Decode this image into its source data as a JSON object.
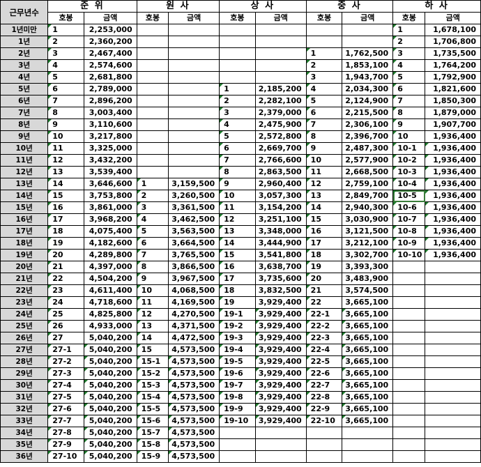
{
  "header": {
    "years_label": "근무년수",
    "grade_label": "호봉",
    "amount_label": "금액",
    "ranks": [
      "준 위",
      "원 사",
      "상 사",
      "중 사",
      "하 사"
    ]
  },
  "rows": [
    [
      "1년미만",
      "1",
      "2,253,000",
      "",
      "",
      "",
      "",
      "",
      "",
      "1",
      "1,678,100"
    ],
    [
      "1년",
      "2",
      "2,360,200",
      "",
      "",
      "",
      "",
      "",
      "",
      "2",
      "1,706,800"
    ],
    [
      "2년",
      "3",
      "2,467,400",
      "",
      "",
      "",
      "",
      "1",
      "1,762,500",
      "3",
      "1,735,500"
    ],
    [
      "3년",
      "4",
      "2,574,600",
      "",
      "",
      "",
      "",
      "2",
      "1,853,100",
      "4",
      "1,764,200"
    ],
    [
      "4년",
      "5",
      "2,681,800",
      "",
      "",
      "",
      "",
      "3",
      "1,943,700",
      "5",
      "1,792,900"
    ],
    [
      "5년",
      "6",
      "2,789,000",
      "",
      "",
      "1",
      "2,185,200",
      "4",
      "2,034,300",
      "6",
      "1,821,600"
    ],
    [
      "6년",
      "7",
      "2,896,200",
      "",
      "",
      "2",
      "2,282,100",
      "5",
      "2,124,900",
      "7",
      "1,850,300"
    ],
    [
      "7년",
      "8",
      "3,003,400",
      "",
      "",
      "3",
      "2,379,000",
      "6",
      "2,215,500",
      "8",
      "1,879,000"
    ],
    [
      "8년",
      "9",
      "3,110,600",
      "",
      "",
      "4",
      "2,475,900",
      "7",
      "2,306,100",
      "9",
      "1,907,700"
    ],
    [
      "9년",
      "10",
      "3,217,800",
      "",
      "",
      "5",
      "2,572,800",
      "8",
      "2,396,700",
      "10",
      "1,936,400"
    ],
    [
      "10년",
      "11",
      "3,325,000",
      "",
      "",
      "6",
      "2,669,700",
      "9",
      "2,487,300",
      "10-1",
      "1,936,400"
    ],
    [
      "11년",
      "12",
      "3,432,200",
      "",
      "",
      "7",
      "2,766,600",
      "10",
      "2,577,900",
      "10-2",
      "1,936,400"
    ],
    [
      "12년",
      "13",
      "3,539,400",
      "",
      "",
      "8",
      "2,863,500",
      "11",
      "2,668,500",
      "10-3",
      "1,936,400"
    ],
    [
      "13년",
      "14",
      "3,646,600",
      "1",
      "3,159,500",
      "9",
      "2,960,400",
      "12",
      "2,759,100",
      "10-4",
      "1,936,400"
    ],
    [
      "14년",
      "15",
      "3,753,800",
      "2",
      "3,260,500",
      "10",
      "3,057,300",
      "13",
      "2,849,700",
      "10-5",
      "1,936,400"
    ],
    [
      "15년",
      "16",
      "3,861,000",
      "3",
      "3,361,500",
      "11",
      "3,154,200",
      "14",
      "2,940,300",
      "10-6",
      "1,936,400"
    ],
    [
      "16년",
      "17",
      "3,968,200",
      "4",
      "3,462,500",
      "12",
      "3,251,100",
      "15",
      "3,030,900",
      "10-7",
      "1,936,400"
    ],
    [
      "17년",
      "18",
      "4,075,400",
      "5",
      "3,563,500",
      "13",
      "3,348,000",
      "16",
      "3,121,500",
      "10-8",
      "1,936,400"
    ],
    [
      "18년",
      "19",
      "4,182,600",
      "6",
      "3,664,500",
      "14",
      "3,444,900",
      "17",
      "3,212,100",
      "10-9",
      "1,936,400"
    ],
    [
      "19년",
      "20",
      "4,289,800",
      "7",
      "3,765,500",
      "15",
      "3,541,800",
      "18",
      "3,302,700",
      "10-10",
      "1,936,400"
    ],
    [
      "20년",
      "21",
      "4,397,000",
      "8",
      "3,866,500",
      "16",
      "3,638,700",
      "19",
      "3,393,300",
      "",
      ""
    ],
    [
      "21년",
      "22",
      "4,504,200",
      "9",
      "3,967,500",
      "17",
      "3,735,600",
      "20",
      "3,483,900",
      "",
      ""
    ],
    [
      "22년",
      "23",
      "4,611,400",
      "10",
      "4,068,500",
      "18",
      "3,832,500",
      "21",
      "3,574,500",
      "",
      ""
    ],
    [
      "23년",
      "24",
      "4,718,600",
      "11",
      "4,169,500",
      "19",
      "3,929,400",
      "22",
      "3,665,100",
      "",
      ""
    ],
    [
      "24년",
      "25",
      "4,825,800",
      "12",
      "4,270,500",
      "19-1",
      "3,929,400",
      "22-1",
      "3,665,100",
      "",
      ""
    ],
    [
      "25년",
      "26",
      "4,933,000",
      "13",
      "4,371,500",
      "19-2",
      "3,929,400",
      "22-2",
      "3,665,100",
      "",
      ""
    ],
    [
      "26년",
      "27",
      "5,040,200",
      "14",
      "4,472,500",
      "19-3",
      "3,929,400",
      "22-3",
      "3,665,100",
      "",
      ""
    ],
    [
      "27년",
      "27-1",
      "5,040,200",
      "15",
      "4,573,500",
      "19-4",
      "3,929,400",
      "22-4",
      "3,665,100",
      "",
      ""
    ],
    [
      "28년",
      "27-2",
      "5,040,200",
      "15-1",
      "4,573,500",
      "19-5",
      "3,929,400",
      "22-5",
      "3,665,100",
      "",
      ""
    ],
    [
      "29년",
      "27-3",
      "5,040,200",
      "15-2",
      "4,573,500",
      "19-6",
      "3,929,400",
      "22-6",
      "3,665,100",
      "",
      ""
    ],
    [
      "30년",
      "27-4",
      "5,040,200",
      "15-3",
      "4,573,500",
      "19-7",
      "3,929,400",
      "22-7",
      "3,665,100",
      "",
      ""
    ],
    [
      "31년",
      "27-5",
      "5,040,200",
      "15-4",
      "4,573,500",
      "19-8",
      "3,929,400",
      "22-8",
      "3,665,100",
      "",
      ""
    ],
    [
      "32년",
      "27-6",
      "5,040,200",
      "15-5",
      "4,573,500",
      "19-9",
      "3,929,400",
      "22-9",
      "3,665,100",
      "",
      ""
    ],
    [
      "33년",
      "27-7",
      "5,040,200",
      "15-6",
      "4,573,500",
      "19-10",
      "3,929,400",
      "22-10",
      "3,665,100",
      "",
      ""
    ],
    [
      "34년",
      "27-8",
      "5,040,200",
      "15-7",
      "4,573,500",
      "",
      "",
      "",
      "",
      "",
      ""
    ],
    [
      "35년",
      "27-9",
      "5,040,200",
      "15-8",
      "4,573,500",
      "",
      "",
      "",
      "",
      "",
      ""
    ],
    [
      "36년",
      "27-10",
      "5,040,200",
      "15-9",
      "4,573,500",
      "",
      "",
      "",
      "",
      "",
      ""
    ]
  ],
  "colors": {
    "years_bg": "#d8d8d8",
    "marker": "#1e7a2c",
    "grid": "#000000"
  }
}
